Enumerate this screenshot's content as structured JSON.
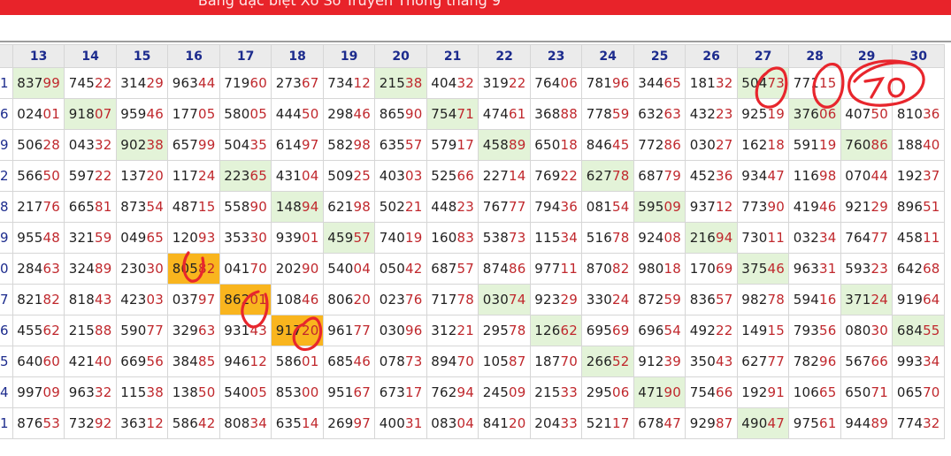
{
  "header": {
    "title": "Bảng đặc biệt Xổ Số Truyền Thống tháng 9"
  },
  "annotation": {
    "handwritten_number": "70"
  },
  "colors": {
    "banner": "#e8232a",
    "highlight_green": "#e3f3d8",
    "highlight_orange": "#f9b51e",
    "header_text": "#1c2b8d",
    "tail_digits": "#c0282d"
  },
  "table": {
    "columns": [
      "13",
      "14",
      "15",
      "16",
      "17",
      "18",
      "19",
      "20",
      "21",
      "22",
      "23",
      "24",
      "25",
      "26",
      "27",
      "28",
      "29",
      "30"
    ],
    "rows": [
      {
        "label": "1",
        "cells": [
          "83799",
          "74522",
          "31429",
          "96344",
          "71960",
          "27367",
          "73412",
          "21538",
          "40432",
          "31922",
          "76406",
          "78196",
          "34465",
          "18132",
          "50473",
          "77115",
          "",
          ""
        ]
      },
      {
        "label": "6",
        "cells": [
          "02401",
          "91807",
          "95946",
          "17705",
          "58005",
          "44450",
          "29846",
          "86590",
          "75471",
          "47461",
          "36888",
          "77859",
          "63263",
          "43223",
          "92519",
          "37606",
          "40750",
          "81036"
        ]
      },
      {
        "label": "9",
        "cells": [
          "50628",
          "04332",
          "90238",
          "65799",
          "50435",
          "61497",
          "58298",
          "63557",
          "57917",
          "45889",
          "65018",
          "84645",
          "77286",
          "03027",
          "16218",
          "59119",
          "76086",
          "18840"
        ]
      },
      {
        "label": "2",
        "cells": [
          "56650",
          "59722",
          "13720",
          "11724",
          "22365",
          "43104",
          "50925",
          "40303",
          "52566",
          "22714",
          "76922",
          "62778",
          "68779",
          "45236",
          "93447",
          "11698",
          "07044",
          "19237"
        ]
      },
      {
        "label": "8",
        "cells": [
          "21776",
          "66581",
          "87354",
          "48715",
          "55890",
          "14894",
          "62198",
          "50221",
          "44823",
          "76777",
          "79436",
          "08154",
          "59509",
          "93712",
          "77390",
          "41946",
          "92129",
          "89651"
        ]
      },
      {
        "label": "9",
        "cells": [
          "95548",
          "32159",
          "04965",
          "12093",
          "35330",
          "93901",
          "45957",
          "74019",
          "16083",
          "53873",
          "11534",
          "51678",
          "92408",
          "21694",
          "73011",
          "03234",
          "76477",
          "45811"
        ]
      },
      {
        "label": "0",
        "cells": [
          "28463",
          "32489",
          "23030",
          "80582",
          "04170",
          "20290",
          "54004",
          "05042",
          "68757",
          "87486",
          "97711",
          "87082",
          "98018",
          "17069",
          "37546",
          "96331",
          "59323",
          "64268"
        ]
      },
      {
        "label": "7",
        "cells": [
          "82182",
          "81843",
          "42303",
          "03797",
          "86201",
          "10846",
          "80620",
          "02376",
          "71778",
          "03074",
          "92329",
          "33024",
          "87259",
          "83657",
          "98278",
          "59416",
          "37124",
          "91964"
        ]
      },
      {
        "label": "6",
        "cells": [
          "45562",
          "21588",
          "59077",
          "32963",
          "93143",
          "91720",
          "96177",
          "03096",
          "31221",
          "29578",
          "12662",
          "69569",
          "69654",
          "49222",
          "14915",
          "79356",
          "08030",
          "68455"
        ]
      },
      {
        "label": "5",
        "cells": [
          "64060",
          "42140",
          "66956",
          "38485",
          "94612",
          "58601",
          "68546",
          "07873",
          "89470",
          "10587",
          "18770",
          "26652",
          "91239",
          "35043",
          "62777",
          "78296",
          "56766",
          "99334"
        ]
      },
      {
        "label": "4",
        "cells": [
          "99709",
          "96332",
          "11538",
          "13850",
          "54005",
          "85300",
          "95167",
          "67317",
          "76294",
          "24509",
          "21533",
          "29506",
          "47190",
          "75466",
          "19291",
          "10665",
          "65071",
          "06570"
        ]
      },
      {
        "label": "1",
        "cells": [
          "87653",
          "73292",
          "36312",
          "58642",
          "80834",
          "63514",
          "26997",
          "40031",
          "08304",
          "84120",
          "20433",
          "52117",
          "67847",
          "92987",
          "49047",
          "97561",
          "94489",
          "77432"
        ]
      }
    ]
  }
}
